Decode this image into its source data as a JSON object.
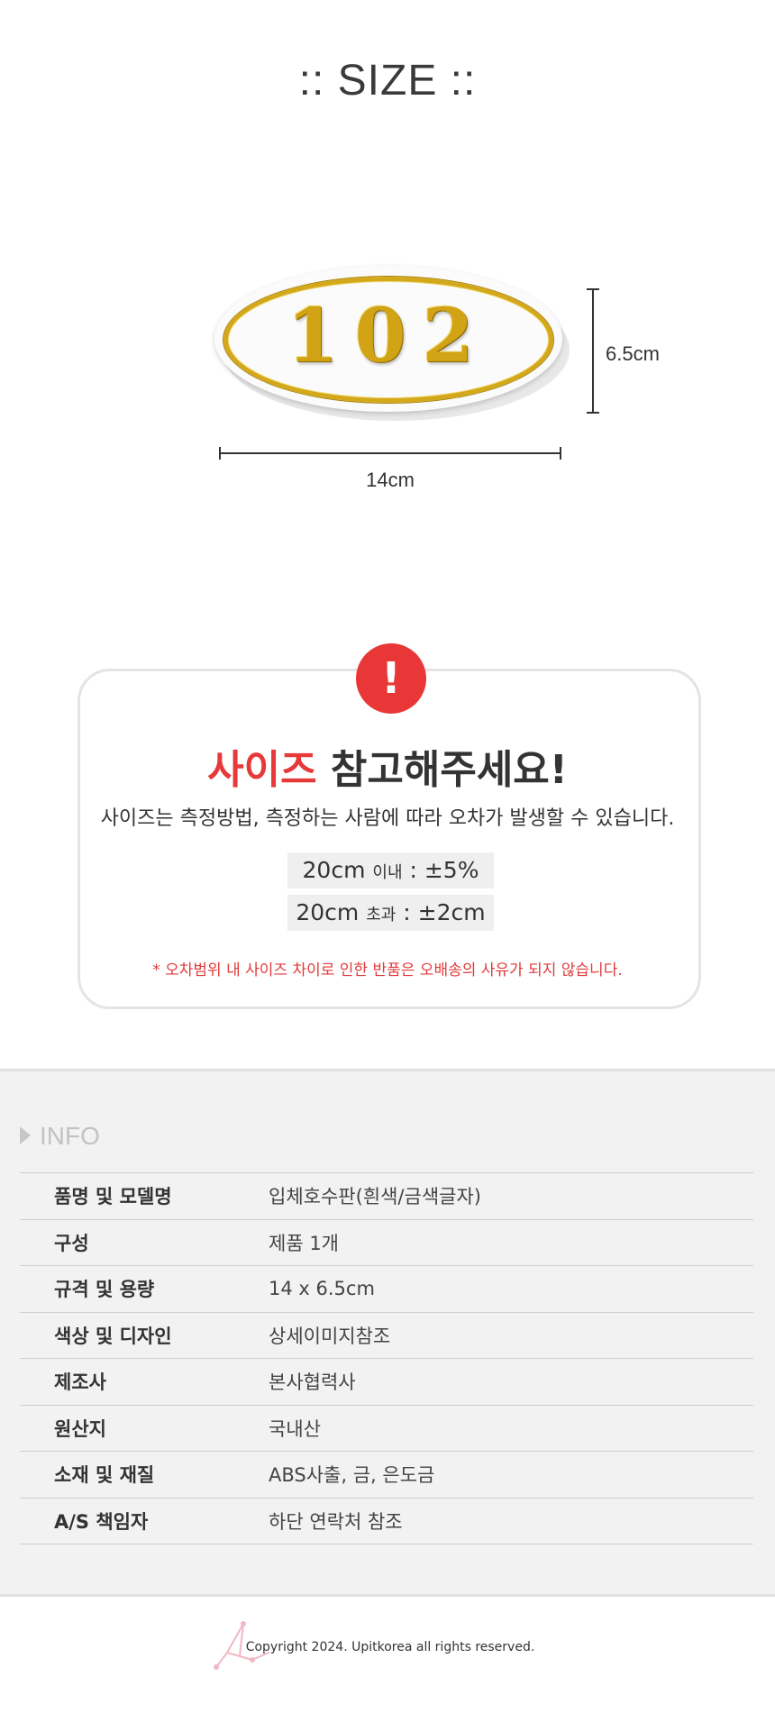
{
  "size_section": {
    "title": ":: SIZE ::",
    "product_number": "102",
    "height_label": "6.5cm",
    "width_label": "14cm"
  },
  "notice": {
    "title_red": "사이즈",
    "title_rest": " 참고해주세요!",
    "description": "사이즈는 측정방법, 측정하는 사람에 따라 오차가 발생할 수 있습니다.",
    "tolerance_1": {
      "size": "20cm",
      "qualifier": "이내",
      "value": " : ±5%"
    },
    "tolerance_2": {
      "size": "20cm",
      "qualifier": "초과",
      "value": " : ±2cm"
    },
    "footnote": "* 오차범위 내 사이즈 차이로 인한 반품은 오배송의 사유가 되지 않습니다.",
    "icon_symbol": "!",
    "accent_color": "#e93737"
  },
  "info": {
    "heading": "INFO",
    "rows": [
      {
        "key": "품명 및 모델명",
        "value": "입체호수판(흰색/금색글자)"
      },
      {
        "key": "구성",
        "value": "제품 1개"
      },
      {
        "key": "규격 및 용량",
        "value": "14 x 6.5cm"
      },
      {
        "key": "색상 및 디자인",
        "value": "상세이미지참조"
      },
      {
        "key": "제조사",
        "value": "본사협력사"
      },
      {
        "key": "원산지",
        "value": "국내산"
      },
      {
        "key": "소재 및 재질",
        "value": "ABS사출, 금, 은도금"
      },
      {
        "key": "A/S 책임자",
        "value": "하단 연락처 참조"
      }
    ]
  },
  "footer": {
    "copyright": "Copyright 2024. Upitkorea all rights reserved."
  }
}
